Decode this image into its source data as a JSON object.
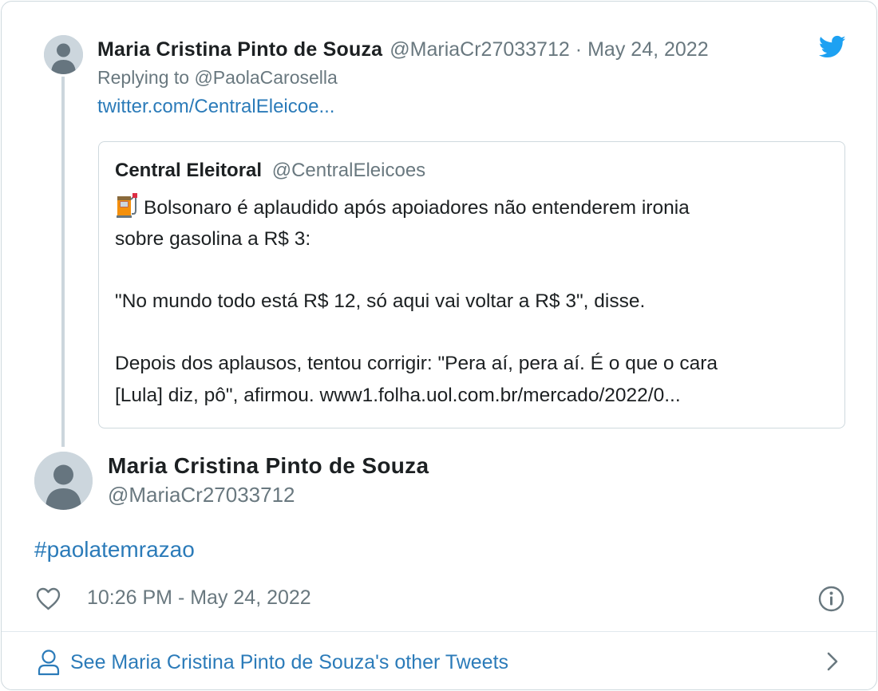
{
  "parent_tweet": {
    "author_name": "Maria Cristina Pinto de Souza",
    "author_handle": "@MariaCr27033712",
    "separator": "·",
    "date": "May 24, 2022",
    "replying_to": "Replying to @PaolaCarosella",
    "link": "twitter.com/CentralEleicoe..."
  },
  "quoted_tweet": {
    "author_name": "Central Eleitoral",
    "author_handle": "@CentralEleicoes",
    "emoji": "fuel-pump-icon",
    "lines": [
      "Bolsonaro é aplaudido após apoiadores não entenderem ironia",
      "sobre gasolina a R$ 3:",
      "\"No mundo todo está R$ 12, só aqui vai voltar a R$ 3\", disse.",
      "Depois dos aplausos, tentou corrigir: \"Pera aí, pera aí. É o que o cara",
      "[Lula] diz, pô\", afirmou. www1.folha.uol.com.br/mercado/2022/0..."
    ]
  },
  "main_tweet": {
    "author_name": "Maria Cristina Pinto de Souza",
    "author_handle": "@MariaCr27033712",
    "text": "#paolatemrazao",
    "timestamp": "10:26 PM - May 24, 2022"
  },
  "footer": {
    "other_tweets_label": "See Maria Cristina Pinto de Souza's other Tweets"
  },
  "colors": {
    "link": "#2b7bb9",
    "muted_text": "#69787f",
    "twitter_blue": "#1da1f2",
    "border": "#cfd9de"
  }
}
